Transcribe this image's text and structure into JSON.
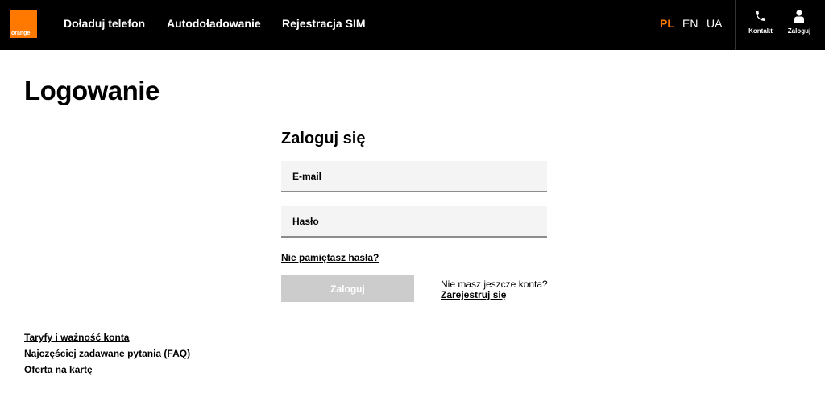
{
  "brand": {
    "logo_text": "orange",
    "accent_color": "#ff7900"
  },
  "nav": {
    "items": [
      {
        "label": "Doładuj telefon"
      },
      {
        "label": "Autodoładowanie"
      },
      {
        "label": "Rejestracja SIM"
      }
    ]
  },
  "languages": [
    {
      "code": "PL",
      "active": true
    },
    {
      "code": "EN",
      "active": false
    },
    {
      "code": "UA",
      "active": false
    }
  ],
  "utility": {
    "contact": {
      "label": "Kontakt",
      "icon": "phone-icon"
    },
    "login": {
      "label": "Zaloguj",
      "icon": "user-icon"
    }
  },
  "page": {
    "title": "Logowanie"
  },
  "form": {
    "title": "Zaloguj się",
    "email_placeholder": "E-mail",
    "password_placeholder": "Hasło",
    "forgot_label": "Nie pamiętasz hasła?",
    "submit_label": "Zaloguj",
    "no_account_text": "Nie masz jeszcze konta?",
    "register_label": "Zarejestruj się"
  },
  "footer": {
    "links": [
      {
        "label": "Taryfy i ważność konta"
      },
      {
        "label": "Najczęściej zadawane pytania (FAQ)"
      },
      {
        "label": "Oferta na kartę"
      }
    ]
  }
}
